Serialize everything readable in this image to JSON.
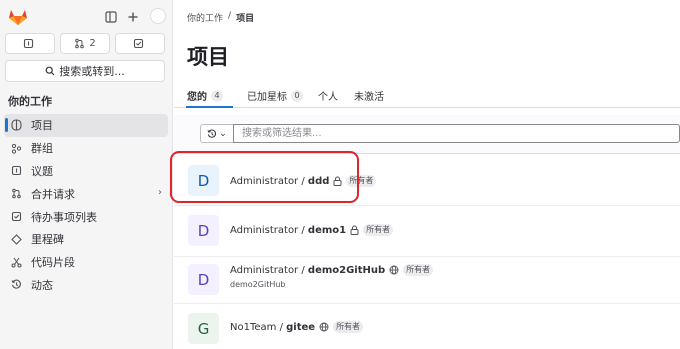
{
  "sidebar": {
    "counters": [
      {
        "icon": "issues-icon",
        "count": ""
      },
      {
        "icon": "merge-request-icon",
        "count": "2"
      },
      {
        "icon": "todo-icon",
        "count": ""
      }
    ],
    "search_label": "搜索或转到...",
    "heading": "你的工作",
    "items": [
      {
        "label": "项目",
        "icon": "project-icon"
      },
      {
        "label": "群组",
        "icon": "group-icon"
      },
      {
        "label": "议题",
        "icon": "issues-icon"
      },
      {
        "label": "合并请求",
        "icon": "merge-request-icon"
      },
      {
        "label": "待办事项列表",
        "icon": "todo-icon"
      },
      {
        "label": "里程碑",
        "icon": "milestone-icon"
      },
      {
        "label": "代码片段",
        "icon": "snippet-icon"
      },
      {
        "label": "动态",
        "icon": "activity-icon"
      }
    ]
  },
  "breadcrumb": {
    "parent": "你的工作",
    "sep": "/",
    "current": "项目"
  },
  "page_title": "项目",
  "tabs": [
    {
      "label": "您的",
      "count": "4"
    },
    {
      "label": "已加星标",
      "count": "0"
    },
    {
      "label": "个人"
    },
    {
      "label": "未激活"
    }
  ],
  "filter": {
    "placeholder": "搜索或筛选结果..."
  },
  "projects": [
    {
      "initial": "D",
      "namespace": "Administrator / ",
      "name": "ddd",
      "visibility": "lock-icon",
      "role": "所有者",
      "description": ""
    },
    {
      "initial": "D",
      "namespace": "Administrator / ",
      "name": "demo1",
      "visibility": "lock-icon",
      "role": "所有者",
      "description": ""
    },
    {
      "initial": "D",
      "namespace": "Administrator / ",
      "name": "demo2GitHub",
      "visibility": "globe-icon",
      "role": "所有者",
      "description": "demo2GitHub"
    },
    {
      "initial": "G",
      "namespace": "No1Team / ",
      "name": "gitee",
      "visibility": "globe-icon",
      "role": "所有者",
      "description": ""
    }
  ],
  "colors": {
    "accent": "#1f75cb",
    "highlight": "#e0242c",
    "avatar_blue": "#e9f3fc",
    "avatar_purple": "#f4f0ff",
    "avatar_green": "#ecf4ee"
  }
}
